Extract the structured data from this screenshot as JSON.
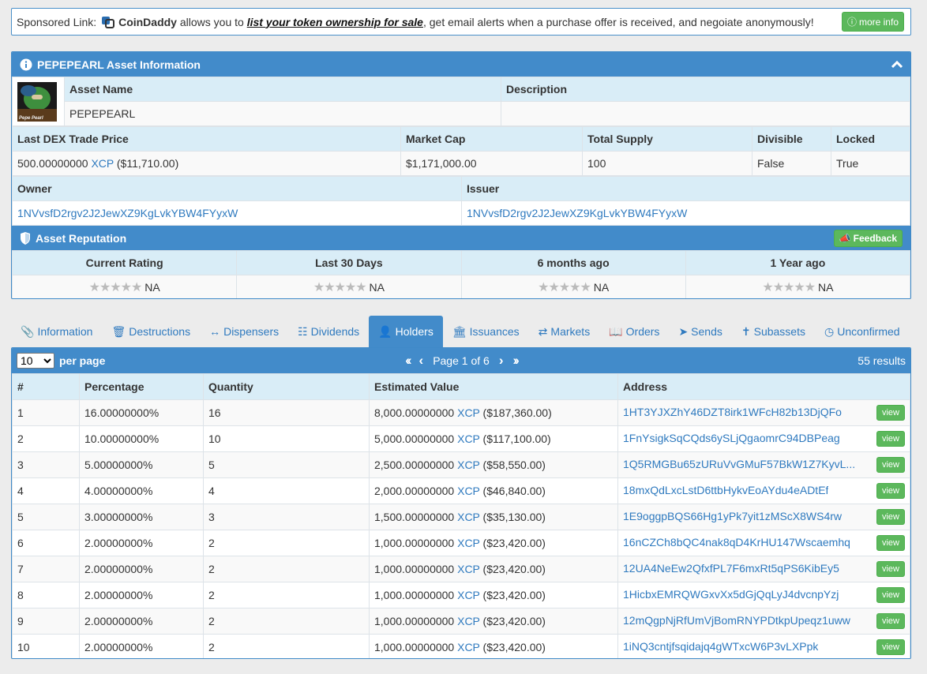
{
  "sponsor": {
    "prefix": "Sponsored Link:",
    "brand": "CoinDaddy",
    "text1": "allows you to",
    "link": "list your token ownership for sale",
    "text2": ", get email alerts when a purchase offer is received, and negoiate anonymously!",
    "button": "more info"
  },
  "asset": {
    "title": "PEPEPEARL Asset Information",
    "image_caption": "Pepe Pearl",
    "name_header": "Asset Name",
    "name": "PEPEPEARL",
    "description_header": "Description",
    "description": "",
    "price_header": "Last DEX Trade Price",
    "price_amount": "500.00000000",
    "price_unit": "XCP",
    "price_usd": "($11,710.00)",
    "market_cap_header": "Market Cap",
    "market_cap": "$1,171,000.00",
    "supply_header": "Total Supply",
    "supply": "100",
    "divisible_header": "Divisible",
    "divisible": "False",
    "locked_header": "Locked",
    "locked": "True",
    "owner_header": "Owner",
    "owner": "1NVvsfD2rgv2J2JewXZ9KgLvkYBW4FYyxW",
    "issuer_header": "Issuer",
    "issuer": "1NVvsfD2rgv2J2JewXZ9KgLvkYBW4FYyxW"
  },
  "reputation": {
    "title": "Asset Reputation",
    "feedback": "Feedback",
    "columns": [
      "Current Rating",
      "Last 30 Days",
      "6 months ago",
      "1 Year ago"
    ],
    "values": [
      "NA",
      "NA",
      "NA",
      "NA"
    ]
  },
  "tabs": [
    {
      "label": "Information",
      "icon": "paperclip-icon"
    },
    {
      "label": "Destructions",
      "icon": "trash-icon"
    },
    {
      "label": "Dispensers",
      "icon": "arrows-h-icon"
    },
    {
      "label": "Dividends",
      "icon": "sitemap-icon"
    },
    {
      "label": "Holders",
      "icon": "user-icon"
    },
    {
      "label": "Issuances",
      "icon": "bank-icon"
    },
    {
      "label": "Markets",
      "icon": "exchange-icon"
    },
    {
      "label": "Orders",
      "icon": "book-icon"
    },
    {
      "label": "Sends",
      "icon": "paper-plane-icon"
    },
    {
      "label": "Subassets",
      "icon": "child-icon"
    },
    {
      "label": "Unconfirmed",
      "icon": "clock-icon"
    }
  ],
  "active_tab": "Holders",
  "holders": {
    "per_page_value": "10",
    "per_page_label": "per page",
    "page_text": "Page 1 of 6",
    "results": "55 results",
    "columns": [
      "#",
      "Percentage",
      "Quantity",
      "Estimated Value",
      "Address"
    ],
    "view_label": "view",
    "rows": [
      {
        "n": "1",
        "pct": "16.00000000%",
        "qty": "16",
        "val": "8,000.00000000",
        "unit": "XCP",
        "usd": "($187,360.00)",
        "addr": "1HT3YJXZhY46DZT8irk1WFcH82b13DjQFo"
      },
      {
        "n": "2",
        "pct": "10.00000000%",
        "qty": "10",
        "val": "5,000.00000000",
        "unit": "XCP",
        "usd": "($117,100.00)",
        "addr": "1FnYsigkSqCQds6ySLjQgaomrC94DBPeag"
      },
      {
        "n": "3",
        "pct": "5.00000000%",
        "qty": "5",
        "val": "2,500.00000000",
        "unit": "XCP",
        "usd": "($58,550.00)",
        "addr": "1Q5RMGBu65zURuVvGMuF57BkW1Z7KyvL..."
      },
      {
        "n": "4",
        "pct": "4.00000000%",
        "qty": "4",
        "val": "2,000.00000000",
        "unit": "XCP",
        "usd": "($46,840.00)",
        "addr": "18mxQdLxcLstD6ttbHykvEoAYdu4eADtEf"
      },
      {
        "n": "5",
        "pct": "3.00000000%",
        "qty": "3",
        "val": "1,500.00000000",
        "unit": "XCP",
        "usd": "($35,130.00)",
        "addr": "1E9oggpBQS66Hg1yPk7yit1zMScX8WS4rw"
      },
      {
        "n": "6",
        "pct": "2.00000000%",
        "qty": "2",
        "val": "1,000.00000000",
        "unit": "XCP",
        "usd": "($23,420.00)",
        "addr": "16nCZCh8bQC4nak8qD4KrHU147Wscaemhq"
      },
      {
        "n": "7",
        "pct": "2.00000000%",
        "qty": "2",
        "val": "1,000.00000000",
        "unit": "XCP",
        "usd": "($23,420.00)",
        "addr": "12UA4NeEw2QfxfPL7F6mxRt5qPS6KibEy5"
      },
      {
        "n": "8",
        "pct": "2.00000000%",
        "qty": "2",
        "val": "1,000.00000000",
        "unit": "XCP",
        "usd": "($23,420.00)",
        "addr": "1HicbxEMRQWGxvXx5dGjQqLyJ4dvcnpYzj"
      },
      {
        "n": "9",
        "pct": "2.00000000%",
        "qty": "2",
        "val": "1,000.00000000",
        "unit": "XCP",
        "usd": "($23,420.00)",
        "addr": "12mQgpNjRfUmVjBomRNYPDtkpUpeqz1uww"
      },
      {
        "n": "10",
        "pct": "2.00000000%",
        "qty": "2",
        "val": "1,000.00000000",
        "unit": "XCP",
        "usd": "($23,420.00)",
        "addr": "1iNQ3cntjfsqidajq4gWTxcW6P3vLXPpk"
      }
    ]
  },
  "colors": {
    "header_blue": "#428bca",
    "light_blue": "#d9edf7",
    "green": "#5cb85c",
    "link": "#2f7abf"
  }
}
